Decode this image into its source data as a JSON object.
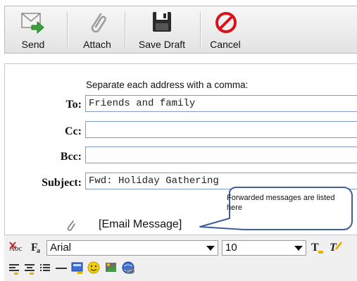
{
  "toolbar": {
    "send_label": "Send",
    "attach_label": "Attach",
    "save_draft_label": "Save Draft",
    "cancel_label": "Cancel"
  },
  "form": {
    "hint": "Separate each address with a comma:",
    "to_label": "To:",
    "to_value": "Friends and family",
    "cc_label": "Cc:",
    "cc_value": "",
    "bcc_label": "Bcc:",
    "bcc_value": "",
    "subject_label": "Subject:",
    "subject_value": "Fwd: Holiday Gathering"
  },
  "attachment": {
    "label": "[Email Message]"
  },
  "callout": {
    "text": "Forwarded messages are listed here"
  },
  "format": {
    "font_value": "Arial",
    "size_value": "10"
  },
  "icons": {
    "send": "envelope-arrow-icon",
    "attach": "paperclip-icon",
    "save_draft": "floppy-disk-icon",
    "cancel": "no-entry-icon",
    "spellcheck": "spellcheck-icon",
    "font_family": "font-family-icon",
    "text_color": "text-color-icon",
    "highlight": "highlight-color-icon",
    "align_left": "align-left-icon",
    "align_center": "align-center-icon",
    "bullets": "bulleted-list-icon",
    "horizontal_rule": "horizontal-rule-icon",
    "insert_box": "insert-box-icon",
    "emoticon": "smiley-icon",
    "image": "image-icon",
    "link": "globe-link-icon"
  },
  "colors": {
    "input_border": "#7d9cc4",
    "cancel_red": "#d9121b",
    "callout_border": "#3d5f9b",
    "send_arrow": "#3aa23a"
  }
}
